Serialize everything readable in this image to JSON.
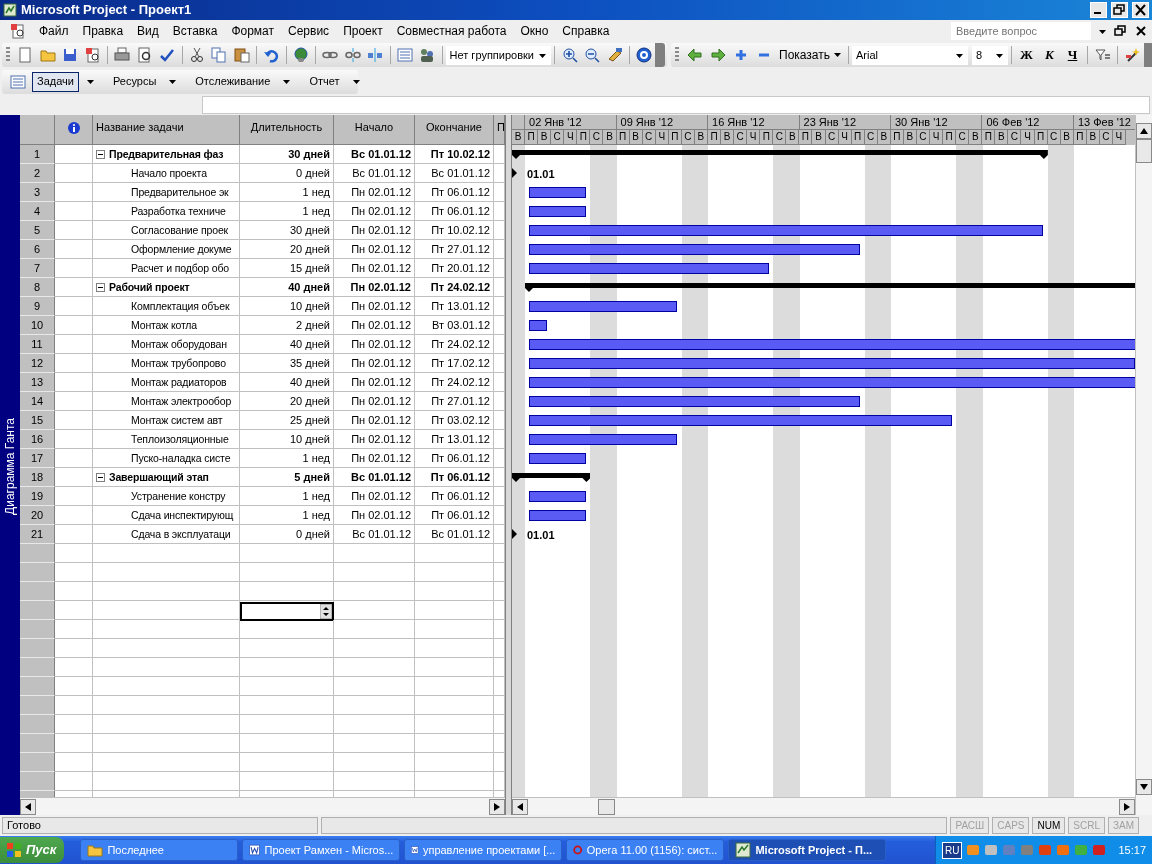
{
  "window": {
    "title": "Microsoft Project - Проект1"
  },
  "menu": [
    "Файл",
    "Правка",
    "Вид",
    "Вставка",
    "Формат",
    "Сервис",
    "Проект",
    "Совместная работа",
    "Окно",
    "Справка"
  ],
  "help_search": {
    "placeholder": "Введите вопрос"
  },
  "toolbar": {
    "grouping": "Нет группировки",
    "show_button": "Показать",
    "font": "Arial",
    "font_size": "8",
    "format_buttons": [
      "Ж",
      "К",
      "Ч"
    ]
  },
  "view_toolbar": {
    "items": [
      {
        "label": "Задачи",
        "selected": true
      },
      {
        "label": "Ресурсы",
        "selected": false
      },
      {
        "label": "Отслеживание",
        "selected": false
      },
      {
        "label": "Отчет",
        "selected": false
      }
    ]
  },
  "view_bar": {
    "label": "Диаграмма Ганта"
  },
  "table": {
    "columns": [
      "Название задачи",
      "Длительность",
      "Начало",
      "Окончание",
      "П"
    ],
    "rows": [
      {
        "id": "1",
        "name": "Предварительная фаз",
        "duration": "30 дней",
        "start": "Вс 01.01.12",
        "finish": "Пт 10.02.12",
        "kind": "summary",
        "expanded": true,
        "children": [
          {
            "id": "2",
            "name": "Начало проекта",
            "duration": "0 дней",
            "start": "Вс 01.01.12",
            "finish": "Вс 01.01.12",
            "kind": "milestone",
            "bar_label": "01.01"
          },
          {
            "id": "3",
            "name": "Предварительное эк",
            "duration": "1 нед",
            "start": "Пн 02.01.12",
            "finish": "Пт 06.01.12",
            "kind": "task"
          },
          {
            "id": "4",
            "name": "Разработка техниче",
            "duration": "1 нед",
            "start": "Пн 02.01.12",
            "finish": "Пт 06.01.12",
            "kind": "task"
          },
          {
            "id": "5",
            "name": "Согласование проек",
            "duration": "30 дней",
            "start": "Пн 02.01.12",
            "finish": "Пт 10.02.12",
            "kind": "task"
          },
          {
            "id": "6",
            "name": "Оформление докуме",
            "duration": "20 дней",
            "start": "Пн 02.01.12",
            "finish": "Пт 27.01.12",
            "kind": "task"
          },
          {
            "id": "7",
            "name": "Расчет и подбор обо",
            "duration": "15 дней",
            "start": "Пн 02.01.12",
            "finish": "Пт 20.01.12",
            "kind": "task"
          }
        ]
      },
      {
        "id": "8",
        "name": "Рабочий проект",
        "duration": "40 дней",
        "start": "Пн 02.01.12",
        "finish": "Пт 24.02.12",
        "kind": "summary",
        "expanded": true,
        "children": [
          {
            "id": "9",
            "name": "Комплектация объек",
            "duration": "10 дней",
            "start": "Пн 02.01.12",
            "finish": "Пт 13.01.12",
            "kind": "task"
          },
          {
            "id": "10",
            "name": "Монтаж котла",
            "duration": "2 дней",
            "start": "Пн 02.01.12",
            "finish": "Вт 03.01.12",
            "kind": "task"
          },
          {
            "id": "11",
            "name": "Монтаж оборудован",
            "duration": "40 дней",
            "start": "Пн 02.01.12",
            "finish": "Пт 24.02.12",
            "kind": "task"
          },
          {
            "id": "12",
            "name": "Монтаж трубопрово",
            "duration": "35 дней",
            "start": "Пн 02.01.12",
            "finish": "Пт 17.02.12",
            "kind": "task"
          },
          {
            "id": "13",
            "name": "Монтаж радиаторов",
            "duration": "40 дней",
            "start": "Пн 02.01.12",
            "finish": "Пт 24.02.12",
            "kind": "task"
          },
          {
            "id": "14",
            "name": "Монтаж электрообор",
            "duration": "20 дней",
            "start": "Пн 02.01.12",
            "finish": "Пт 27.01.12",
            "kind": "task"
          },
          {
            "id": "15",
            "name": "Монтаж систем авт",
            "duration": "25 дней",
            "start": "Пн 02.01.12",
            "finish": "Пт 03.02.12",
            "kind": "task"
          },
          {
            "id": "16",
            "name": "Теплоизоляционные",
            "duration": "10 дней",
            "start": "Пн 02.01.12",
            "finish": "Пт 13.01.12",
            "kind": "task"
          },
          {
            "id": "17",
            "name": "Пуско-наладка систе",
            "duration": "1 нед",
            "start": "Пн 02.01.12",
            "finish": "Пт 06.01.12",
            "kind": "task"
          }
        ]
      },
      {
        "id": "18",
        "name": "Завершающий этап",
        "duration": "5 дней",
        "start": "Вс 01.01.12",
        "finish": "Пт 06.01.12",
        "kind": "summary",
        "expanded": true,
        "children": [
          {
            "id": "19",
            "name": "Устранение констру",
            "duration": "1 нед",
            "start": "Пн 02.01.12",
            "finish": "Пт 06.01.12",
            "kind": "task"
          },
          {
            "id": "20",
            "name": "Сдача инспектирующ",
            "duration": "1 нед",
            "start": "Пн 02.01.12",
            "finish": "Пт 06.01.12",
            "kind": "task"
          },
          {
            "id": "21",
            "name": "Сдача в эксплуатаци",
            "duration": "0 дней",
            "start": "Вс 01.01.12",
            "finish": "Вс 01.01.12",
            "kind": "milestone",
            "bar_label": "01.01"
          }
        ]
      }
    ]
  },
  "timescale": {
    "lead_day": "В",
    "weeks": [
      {
        "label": "02 Янв '12",
        "days": [
          "П",
          "В",
          "С",
          "Ч",
          "П",
          "С",
          "В"
        ]
      },
      {
        "label": "09 Янв '12",
        "days": [
          "П",
          "В",
          "С",
          "Ч",
          "П",
          "С",
          "В"
        ]
      },
      {
        "label": "16 Янв '12",
        "days": [
          "П",
          "В",
          "С",
          "Ч",
          "П",
          "С",
          "В"
        ]
      },
      {
        "label": "23 Янв '12",
        "days": [
          "П",
          "В",
          "С",
          "Ч",
          "П",
          "С",
          "В"
        ]
      },
      {
        "label": "30 Янв '12",
        "days": [
          "П",
          "В",
          "С",
          "Ч",
          "П",
          "С",
          "В"
        ]
      },
      {
        "label": "06 Фев '12",
        "days": [
          "П",
          "В",
          "С",
          "Ч",
          "П",
          "С",
          "В"
        ]
      },
      {
        "label": "13 Фев '12",
        "days": [
          "П",
          "В",
          "С",
          "Ч"
        ]
      }
    ]
  },
  "status_bar": {
    "text": "Готово",
    "indicators": [
      {
        "label": "РАСШ",
        "on": false
      },
      {
        "label": "CAPS",
        "on": false
      },
      {
        "label": "NUM",
        "on": true
      },
      {
        "label": "SCRL",
        "on": false
      },
      {
        "label": "ЗАМ",
        "on": false
      }
    ]
  },
  "taskbar": {
    "start": "Пуск",
    "tasks": [
      {
        "label": "Последнее",
        "selected": false,
        "kind": "folder"
      },
      {
        "label": "Проект Рамхен - Micros...",
        "selected": false,
        "kind": "word"
      },
      {
        "label": "управление проектами [...",
        "selected": false,
        "kind": "word"
      },
      {
        "label": "Opera 11.00 (1156): сист...",
        "selected": false,
        "kind": "opera"
      },
      {
        "label": "Microsoft Project - П...",
        "selected": true,
        "kind": "project"
      }
    ],
    "language": "RU",
    "clock": "15:17"
  }
}
